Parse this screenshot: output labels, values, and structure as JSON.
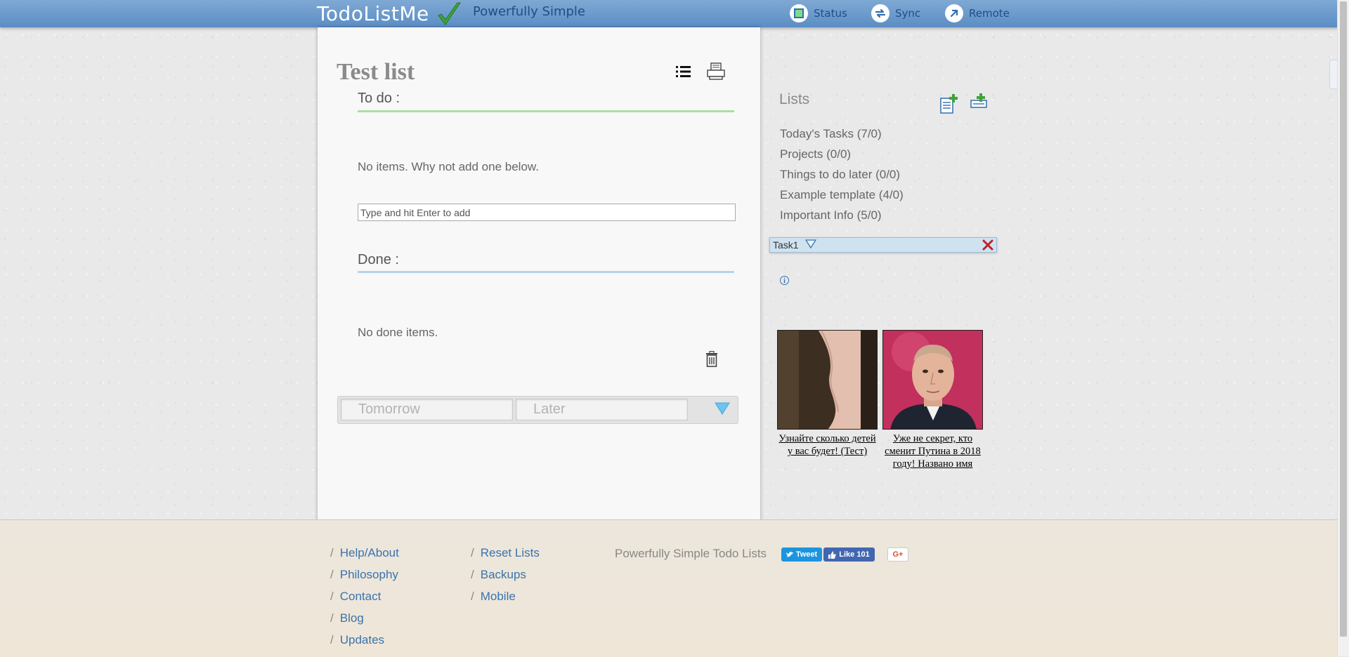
{
  "header": {
    "logo_text": "TodoListMe",
    "tagline": "Powerfully Simple",
    "nav": [
      {
        "label": "Status",
        "icon": "status-icon"
      },
      {
        "label": "Sync",
        "icon": "sync-icon"
      },
      {
        "label": "Remote",
        "icon": "remote-icon"
      }
    ]
  },
  "main": {
    "list_title": "Test list",
    "todo": {
      "heading": "To do :",
      "empty_message": "No items. Why not add one below.",
      "input_placeholder": "Type and hit Enter to add"
    },
    "done": {
      "heading": "Done :",
      "empty_message": "No done items."
    },
    "schedule_tabs": [
      "Tomorrow",
      "Later"
    ]
  },
  "sidebar": {
    "heading": "Lists",
    "lists": [
      {
        "label": "Today's Tasks (7/0)"
      },
      {
        "label": "Projects (0/0)"
      },
      {
        "label": "Things to do later (0/0)"
      },
      {
        "label": "Example template (4/0)"
      },
      {
        "label": "Important Info (5/0)"
      }
    ],
    "active_item": "Task1"
  },
  "ads": [
    {
      "caption": "Узнайте сколько детей у вас будет! (Тест)"
    },
    {
      "caption": "Уже не секрет, кто сменит Путина в 2018 году! Названо имя"
    }
  ],
  "footer": {
    "col1": [
      "Help/About",
      "Philosophy",
      "Contact",
      "Blog",
      "Updates"
    ],
    "col2": [
      "Reset Lists",
      "Backups",
      "Mobile"
    ],
    "tagline": "Powerfully Simple Todo Lists",
    "social": {
      "tweet": "Tweet",
      "like": "Like 101",
      "gplus": "G+"
    }
  },
  "colors": {
    "header_blue": "#5b8dc4",
    "todo_rule": "#a8e0a0",
    "done_rule": "#b6d3ea",
    "link_blue": "#3a73ad"
  }
}
